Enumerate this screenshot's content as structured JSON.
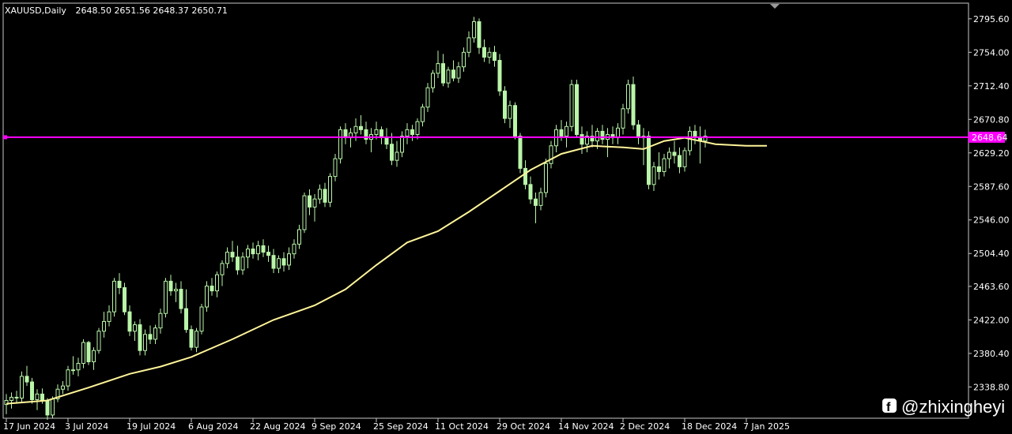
{
  "header": {
    "symbol": "XAUUSD,Daily",
    "ohlc": "2648.50 2651.56 2648.37 2650.71"
  },
  "watermark": {
    "handle": "@zhixingheyi",
    "icon": "facebook-icon"
  },
  "price_marker": {
    "label": "2648.64",
    "value": 2648.64
  },
  "colors": {
    "background": "#000000",
    "candle": "#b9f5a8",
    "moving_average": "#fff59a",
    "horizontal_line": "#ff00ff",
    "text": "#ffffff"
  },
  "chart_data": {
    "type": "line",
    "series_kind": "candlestick",
    "ylim": [
      2300,
      2815
    ],
    "y_ticks": [
      "2795.60",
      "2754.00",
      "2712.40",
      "2670.80",
      "2629.20",
      "2587.60",
      "2546.00",
      "2504.40",
      "2463.60",
      "2422.00",
      "2380.40",
      "2338.80"
    ],
    "x_tick_labels": [
      "17 Jun 2024",
      "3 Jul 2024",
      "19 Jul 2024",
      "6 Aug 2024",
      "22 Aug 2024",
      "9 Sep 2024",
      "25 Sep 2024",
      "11 Oct 2024",
      "29 Oct 2024",
      "14 Nov 2024",
      "2 Dec 2024",
      "18 Dec 2024",
      "7 Jan 2025"
    ],
    "x_tick_index": [
      0,
      12,
      24,
      36,
      48,
      60,
      72,
      84,
      96,
      108,
      120,
      132,
      144
    ],
    "candles": [
      [
        2317,
        2330,
        2305,
        2322
      ],
      [
        2322,
        2332,
        2312,
        2326
      ],
      [
        2326,
        2334,
        2318,
        2325
      ],
      [
        2325,
        2358,
        2320,
        2352
      ],
      [
        2352,
        2365,
        2340,
        2345
      ],
      [
        2345,
        2350,
        2318,
        2323
      ],
      [
        2323,
        2336,
        2310,
        2330
      ],
      [
        2330,
        2337,
        2318,
        2322
      ],
      [
        2322,
        2325,
        2298,
        2304
      ],
      [
        2304,
        2327,
        2300,
        2324
      ],
      [
        2324,
        2342,
        2320,
        2336
      ],
      [
        2336,
        2346,
        2330,
        2340
      ],
      [
        2340,
        2365,
        2334,
        2360
      ],
      [
        2360,
        2377,
        2354,
        2360
      ],
      [
        2360,
        2375,
        2352,
        2368
      ],
      [
        2368,
        2398,
        2362,
        2394
      ],
      [
        2394,
        2396,
        2366,
        2370
      ],
      [
        2370,
        2388,
        2360,
        2384
      ],
      [
        2384,
        2412,
        2380,
        2408
      ],
      [
        2408,
        2432,
        2400,
        2420
      ],
      [
        2420,
        2440,
        2414,
        2432
      ],
      [
        2432,
        2474,
        2426,
        2470
      ],
      [
        2470,
        2480,
        2454,
        2462
      ],
      [
        2462,
        2468,
        2428,
        2432
      ],
      [
        2432,
        2440,
        2402,
        2408
      ],
      [
        2408,
        2420,
        2396,
        2416
      ],
      [
        2416,
        2423,
        2378,
        2384
      ],
      [
        2384,
        2410,
        2378,
        2404
      ],
      [
        2404,
        2415,
        2392,
        2398
      ],
      [
        2398,
        2416,
        2392,
        2412
      ],
      [
        2412,
        2436,
        2405,
        2430
      ],
      [
        2430,
        2474,
        2425,
        2470
      ],
      [
        2470,
        2478,
        2452,
        2458
      ],
      [
        2458,
        2468,
        2444,
        2460
      ],
      [
        2460,
        2470,
        2430,
        2436
      ],
      [
        2436,
        2460,
        2406,
        2410
      ],
      [
        2410,
        2415,
        2384,
        2388
      ],
      [
        2388,
        2412,
        2382,
        2408
      ],
      [
        2408,
        2442,
        2404,
        2438
      ],
      [
        2438,
        2470,
        2432,
        2464
      ],
      [
        2464,
        2474,
        2452,
        2458
      ],
      [
        2458,
        2482,
        2450,
        2478
      ],
      [
        2478,
        2496,
        2464,
        2492
      ],
      [
        2492,
        2512,
        2486,
        2506
      ],
      [
        2506,
        2520,
        2494,
        2500
      ],
      [
        2500,
        2514,
        2478,
        2484
      ],
      [
        2484,
        2506,
        2478,
        2500
      ],
      [
        2500,
        2515,
        2486,
        2510
      ],
      [
        2510,
        2518,
        2498,
        2504
      ],
      [
        2504,
        2520,
        2496,
        2514
      ],
      [
        2514,
        2522,
        2500,
        2506
      ],
      [
        2506,
        2514,
        2494,
        2502
      ],
      [
        2502,
        2510,
        2480,
        2486
      ],
      [
        2486,
        2502,
        2480,
        2498
      ],
      [
        2498,
        2506,
        2482,
        2490
      ],
      [
        2490,
        2512,
        2484,
        2504
      ],
      [
        2504,
        2522,
        2498,
        2516
      ],
      [
        2516,
        2540,
        2510,
        2534
      ],
      [
        2534,
        2580,
        2530,
        2576
      ],
      [
        2576,
        2584,
        2552,
        2562
      ],
      [
        2562,
        2578,
        2544,
        2572
      ],
      [
        2572,
        2590,
        2566,
        2584
      ],
      [
        2584,
        2592,
        2562,
        2568
      ],
      [
        2568,
        2604,
        2562,
        2600
      ],
      [
        2600,
        2628,
        2594,
        2622
      ],
      [
        2622,
        2662,
        2616,
        2658
      ],
      [
        2658,
        2666,
        2640,
        2648
      ],
      [
        2648,
        2660,
        2636,
        2654
      ],
      [
        2654,
        2672,
        2644,
        2662
      ],
      [
        2662,
        2676,
        2652,
        2658
      ],
      [
        2658,
        2668,
        2640,
        2646
      ],
      [
        2646,
        2660,
        2630,
        2652
      ],
      [
        2652,
        2668,
        2646,
        2658
      ],
      [
        2658,
        2662,
        2640,
        2648
      ],
      [
        2648,
        2660,
        2634,
        2640
      ],
      [
        2640,
        2654,
        2614,
        2620
      ],
      [
        2620,
        2644,
        2612,
        2630
      ],
      [
        2630,
        2656,
        2624,
        2650
      ],
      [
        2650,
        2666,
        2640,
        2658
      ],
      [
        2658,
        2664,
        2644,
        2652
      ],
      [
        2652,
        2672,
        2646,
        2668
      ],
      [
        2668,
        2690,
        2662,
        2686
      ],
      [
        2686,
        2716,
        2680,
        2710
      ],
      [
        2710,
        2732,
        2704,
        2728
      ],
      [
        2728,
        2756,
        2722,
        2740
      ],
      [
        2740,
        2752,
        2712,
        2716
      ],
      [
        2716,
        2736,
        2710,
        2732
      ],
      [
        2732,
        2744,
        2718,
        2722
      ],
      [
        2722,
        2742,
        2716,
        2736
      ],
      [
        2736,
        2760,
        2730,
        2754
      ],
      [
        2754,
        2780,
        2748,
        2772
      ],
      [
        2772,
        2798,
        2766,
        2792
      ],
      [
        2792,
        2796,
        2752,
        2760
      ],
      [
        2760,
        2770,
        2742,
        2748
      ],
      [
        2748,
        2760,
        2740,
        2754
      ],
      [
        2754,
        2762,
        2736,
        2744
      ],
      [
        2744,
        2752,
        2700,
        2706
      ],
      [
        2706,
        2712,
        2666,
        2672
      ],
      [
        2672,
        2694,
        2660,
        2688
      ],
      [
        2688,
        2692,
        2646,
        2650
      ],
      [
        2650,
        2654,
        2604,
        2610
      ],
      [
        2610,
        2620,
        2584,
        2590
      ],
      [
        2590,
        2600,
        2566,
        2572
      ],
      [
        2572,
        2580,
        2542,
        2564
      ],
      [
        2564,
        2586,
        2558,
        2580
      ],
      [
        2580,
        2622,
        2574,
        2616
      ],
      [
        2616,
        2644,
        2610,
        2638
      ],
      [
        2638,
        2664,
        2630,
        2658
      ],
      [
        2658,
        2670,
        2644,
        2650
      ],
      [
        2650,
        2668,
        2636,
        2662
      ],
      [
        2662,
        2720,
        2656,
        2714
      ],
      [
        2714,
        2720,
        2648,
        2652
      ],
      [
        2652,
        2662,
        2628,
        2640
      ],
      [
        2640,
        2656,
        2630,
        2650
      ],
      [
        2650,
        2664,
        2636,
        2644
      ],
      [
        2644,
        2660,
        2634,
        2656
      ],
      [
        2656,
        2664,
        2640,
        2646
      ],
      [
        2646,
        2660,
        2624,
        2652
      ],
      [
        2652,
        2662,
        2640,
        2648
      ],
      [
        2648,
        2666,
        2640,
        2660
      ],
      [
        2660,
        2690,
        2652,
        2684
      ],
      [
        2684,
        2720,
        2678,
        2714
      ],
      [
        2714,
        2724,
        2658,
        2664
      ],
      [
        2664,
        2670,
        2640,
        2648
      ],
      [
        2648,
        2660,
        2614,
        2650
      ],
      [
        2650,
        2656,
        2584,
        2590
      ],
      [
        2590,
        2618,
        2582,
        2612
      ],
      [
        2612,
        2630,
        2596,
        2606
      ],
      [
        2606,
        2628,
        2600,
        2622
      ],
      [
        2622,
        2636,
        2610,
        2630
      ],
      [
        2630,
        2644,
        2616,
        2626
      ],
      [
        2626,
        2636,
        2604,
        2612
      ],
      [
        2612,
        2636,
        2606,
        2632
      ],
      [
        2632,
        2662,
        2626,
        2656
      ],
      [
        2656,
        2664,
        2640,
        2648
      ],
      [
        2648,
        2662,
        2616,
        2644
      ],
      [
        2644,
        2658,
        2636,
        2650
      ]
    ],
    "moving_average": {
      "name": "",
      "points": [
        [
          0,
          2318
        ],
        [
          8,
          2322
        ],
        [
          16,
          2338
        ],
        [
          24,
          2355
        ],
        [
          30,
          2364
        ],
        [
          36,
          2376
        ],
        [
          44,
          2398
        ],
        [
          52,
          2422
        ],
        [
          60,
          2440
        ],
        [
          66,
          2460
        ],
        [
          72,
          2490
        ],
        [
          78,
          2518
        ],
        [
          84,
          2532
        ],
        [
          90,
          2556
        ],
        [
          96,
          2582
        ],
        [
          102,
          2608
        ],
        [
          108,
          2628
        ],
        [
          114,
          2638
        ],
        [
          120,
          2636
        ],
        [
          124,
          2634
        ],
        [
          128,
          2644
        ],
        [
          132,
          2648
        ],
        [
          138,
          2640
        ],
        [
          144,
          2638
        ],
        [
          148,
          2638
        ]
      ]
    }
  }
}
